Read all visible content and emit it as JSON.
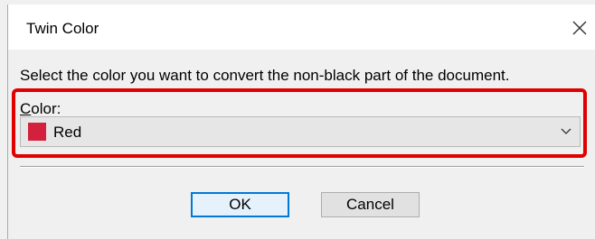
{
  "dialog": {
    "title": "Twin Color",
    "close_glyph": "✕",
    "instruction": "Select the color you want to convert the non-black part of the document.",
    "color_label": {
      "accelerator": "C",
      "rest": "olor:"
    },
    "color_select": {
      "selected_value": "Red",
      "swatch_color": "#d3203c",
      "icon": "chevron-down-icon"
    },
    "highlight_color": "#e00000",
    "buttons": {
      "ok_label": "OK",
      "cancel_label": "Cancel"
    }
  }
}
